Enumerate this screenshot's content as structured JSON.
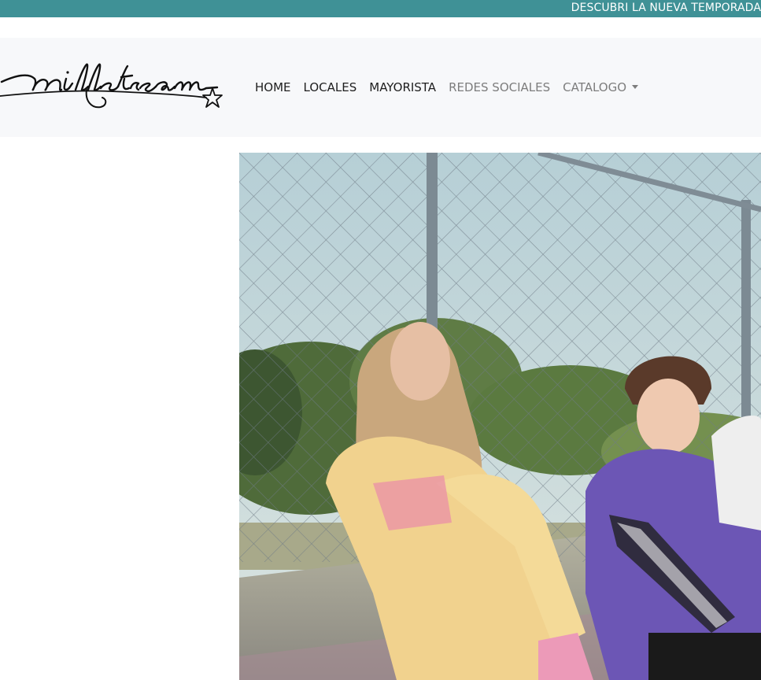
{
  "announcement": {
    "text": "DESCUBRI LA NUEVA TEMPORADA",
    "background": "#3f9196"
  },
  "brand": {
    "logo_text": "millstream",
    "logo_icon": "star-icon"
  },
  "nav": {
    "items": [
      {
        "label": "HOME",
        "active": true
      },
      {
        "label": "LOCALES",
        "active": true
      },
      {
        "label": "MAYORISTA",
        "active": true
      },
      {
        "label": "REDES SOCIALES",
        "active": false
      },
      {
        "label": "CATALOGO",
        "active": false,
        "dropdown": true
      }
    ]
  },
  "hero": {
    "image": "kids-in-hoodies-photo"
  }
}
